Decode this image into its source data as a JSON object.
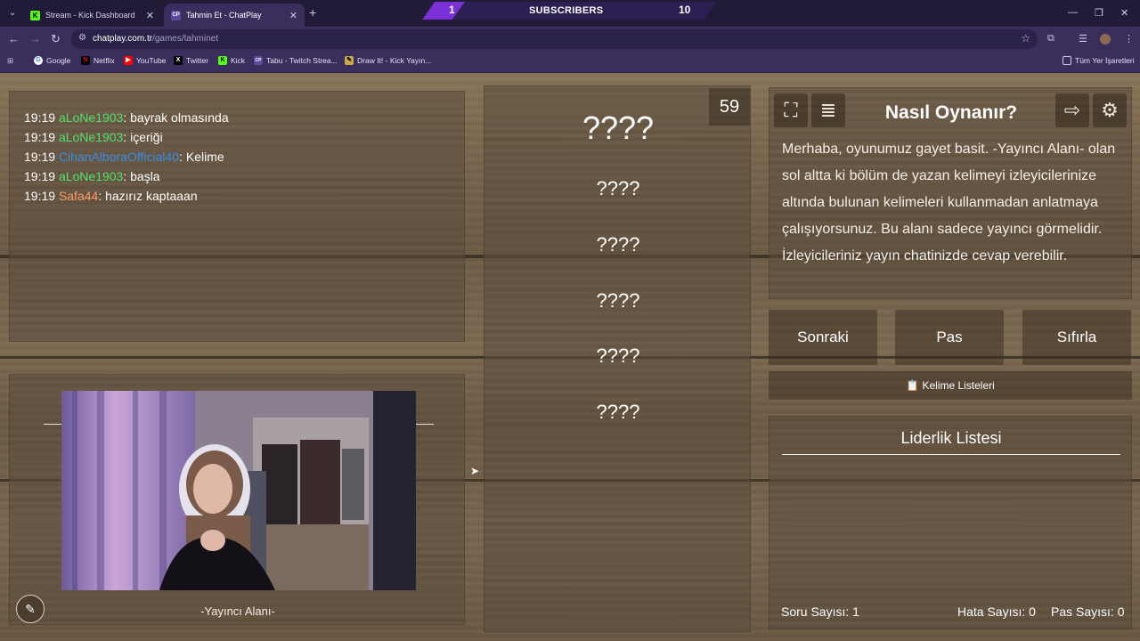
{
  "browser": {
    "tabs": [
      {
        "title": "Stream - Kick Dashboard",
        "favicon": "kick-icon"
      },
      {
        "title": "Tahmin Et - ChatPlay",
        "favicon": "chatplay-icon",
        "active": true
      }
    ],
    "subscriber_bar": {
      "left_count": "1",
      "label": "SUBSCRIBERS",
      "right_count": "10"
    },
    "url_host": "chatplay.com.tr",
    "url_path": "/games/tahminet",
    "bookmarks": [
      "Google",
      "Netflix",
      "YouTube",
      "Twitter",
      "Kick",
      "Tabu - Twitch Strea...",
      "Draw It! - Kick Yayın..."
    ],
    "all_bookmarks": "Tüm Yer İşaretleri"
  },
  "chat": {
    "messages": [
      {
        "time": "19:19",
        "user": "aLoNe1903",
        "user_color": "#52e06a",
        "text": ": bayrak olmasında"
      },
      {
        "time": "19:19",
        "user": "aLoNe1903",
        "user_color": "#52e06a",
        "text": ": içeriği"
      },
      {
        "time": "19:19",
        "user": "CihanAlboraOfficial40",
        "user_color": "#3c8ce0",
        "text": ": Kelime"
      },
      {
        "time": "19:19",
        "user": "aLoNe1903",
        "user_color": "#52e06a",
        "text": ": başla"
      },
      {
        "time": "19:19",
        "user": "Safa44",
        "user_color": "#ff9c6a",
        "text": ": hazırız kaptaaan"
      }
    ]
  },
  "streamer": {
    "caption": "-Yayıncı Alanı-"
  },
  "words": {
    "timer": "59",
    "list": [
      "????",
      "????",
      "????",
      "????",
      "????",
      "????"
    ]
  },
  "howto": {
    "title": "Nasıl Oynanır?",
    "body": "Merhaba, oyunumuz gayet basit. -Yayıncı Alanı- olan sol altta ki bölüm de yazan kelimeyi izleyicilerinize altında bulunan kelimeleri kullanmadan anlatmaya çalışıyorsunuz. Bu alanı sadece yayıncı görmelidir. İzleyicileriniz yayın chatinizde cevap verebilir."
  },
  "controls": {
    "next": "Sonraki",
    "pass": "Pas",
    "reset": "Sıfırla",
    "word_lists": "📋 Kelime Listeleri"
  },
  "leaderboard": {
    "title": "Liderlik Listesi"
  },
  "stats": {
    "questions": "Soru Sayısı: 1",
    "errors": "Hata Sayısı: 0",
    "passes": "Pas Sayısı: 0"
  }
}
